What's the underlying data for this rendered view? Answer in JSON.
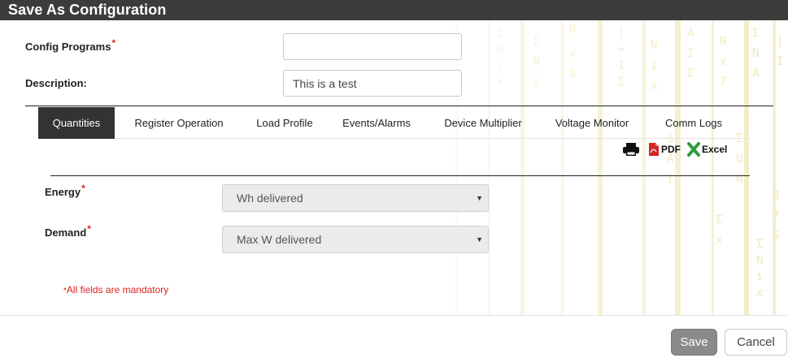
{
  "dialog": {
    "title": "Save As Configuration"
  },
  "form": {
    "config_programs": {
      "label": "Config Programs",
      "required_mark": "*",
      "value": ""
    },
    "description": {
      "label": "Description:",
      "value": "This is a test"
    }
  },
  "tabs": [
    {
      "label": "Quantities",
      "active": true
    },
    {
      "label": "Register Operation",
      "active": false
    },
    {
      "label": "Load Profile",
      "active": false
    },
    {
      "label": "Events/Alarms",
      "active": false
    },
    {
      "label": "Device Multiplier",
      "active": false
    },
    {
      "label": "Voltage Monitor",
      "active": false
    },
    {
      "label": "Comm Logs",
      "active": false
    }
  ],
  "export": {
    "print_icon": "printer-icon",
    "pdf": {
      "icon": "pdf-icon",
      "label": "PDF"
    },
    "excel": {
      "icon": "excel-icon",
      "label": "Excel"
    }
  },
  "quantities": {
    "energy": {
      "label": "Energy",
      "required_mark": "*",
      "selected": "Wh delivered"
    },
    "demand": {
      "label": "Demand",
      "required_mark": "*",
      "selected": "Max W delivered"
    }
  },
  "mandatory_note": {
    "mark": "*",
    "text": "All fields are mandatory"
  },
  "footer": {
    "save_label": "Save",
    "cancel_label": "Cancel"
  },
  "colors": {
    "titlebar": "#3c3c3c",
    "active_tab": "#333333",
    "required": "#e02020",
    "save_button": "#8a8a8a"
  }
}
